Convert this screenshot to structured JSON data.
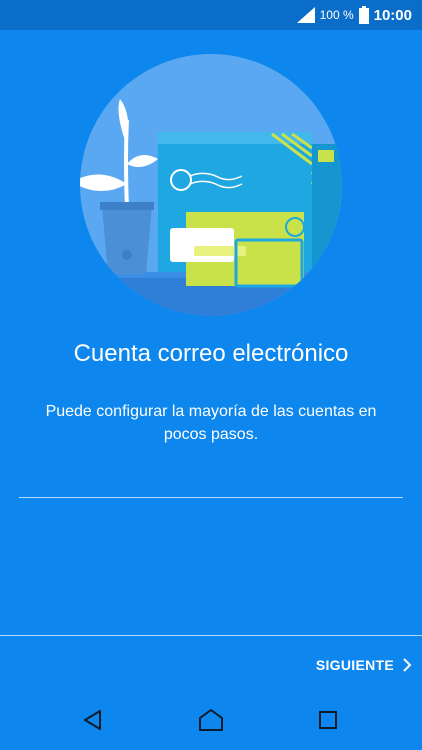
{
  "status_bar": {
    "battery_percent": "100 %",
    "time": "10:00",
    "icons": [
      "signal-icon",
      "battery-icon"
    ]
  },
  "main": {
    "illustration": "email-envelope-illustration",
    "title": "Cuenta correo electrónico",
    "subtitle": "Puede configurar la mayoría de las cuentas en pocos pasos."
  },
  "footer": {
    "next_label": "SIGUIENTE"
  },
  "nav_bar": {
    "icons": [
      "back-icon",
      "home-icon",
      "recent-apps-icon"
    ]
  },
  "colors": {
    "background": "#0d87ee",
    "status_bar": "#0a6dc9",
    "circle": "#5aa8f2",
    "envelope_blue": "#1ea7e0",
    "envelope_yellow": "#c9e24a"
  }
}
